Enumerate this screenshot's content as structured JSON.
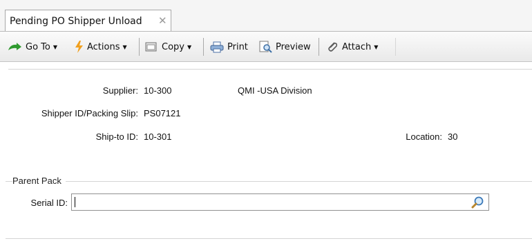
{
  "tab": {
    "title": "Pending PO Shipper Unload",
    "close_glyph": "✕"
  },
  "toolbar": {
    "goto_label": "Go To",
    "actions_label": "Actions",
    "copy_label": "Copy",
    "print_label": "Print",
    "preview_label": "Preview",
    "attach_label": "Attach",
    "caret": "▼"
  },
  "form": {
    "supplier_label": "Supplier:",
    "supplier_code": "10-300",
    "supplier_name": "QMI -USA Division",
    "shipper_label": "Shipper ID/Packing Slip:",
    "shipper_value": "PS07121",
    "shipto_label": "Ship-to ID:",
    "shipto_value": "10-301",
    "location_label": "Location:",
    "location_value": "30"
  },
  "parent_pack": {
    "section_title": "Parent Pack",
    "serial_label": "Serial ID:",
    "serial_value": ""
  },
  "colors": {
    "accent_green": "#2f9a2f",
    "accent_orange": "#f0a020",
    "toolbar_border": "#b9b9b9"
  }
}
